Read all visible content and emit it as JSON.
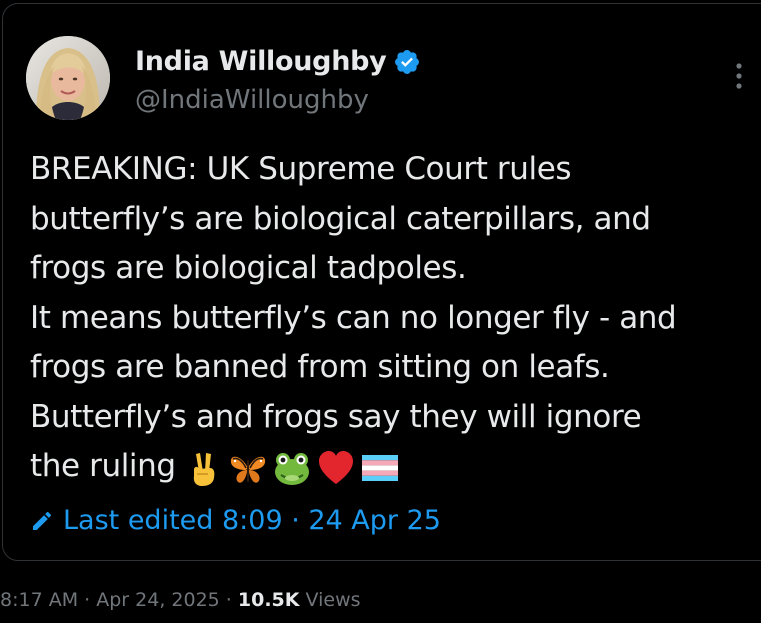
{
  "author": {
    "display_name": "India Willoughby",
    "handle": "@IndiaWilloughby",
    "verified": true,
    "avatar": "profile-photo"
  },
  "tweet": {
    "lines": [
      "BREAKING: UK Supreme Court rules",
      "butterfly’s are biological caterpillars, and",
      "frogs are biological tadpoles.",
      "It means butterfly’s can no longer fly - and",
      "frogs are banned from sitting on leafs.",
      "Butterfly’s and frogs say they will ignore",
      "the ruling"
    ],
    "emojis": [
      "victory-hand-emoji",
      "butterfly-emoji",
      "frog-emoji",
      "red-heart-emoji",
      "transgender-flag-emoji"
    ],
    "edited_label": "Last edited 8:09 · 24 Apr 25"
  },
  "meta": {
    "time": "8:17 AM",
    "separator": " · ",
    "date": "Apr 24, 2025",
    "views_count": "10.5K",
    "views_label": " Views"
  },
  "colors": {
    "background": "#000000",
    "text": "#e7e9ea",
    "secondary": "#71767b",
    "accent": "#1d9bf0",
    "border": "#2f3336"
  }
}
